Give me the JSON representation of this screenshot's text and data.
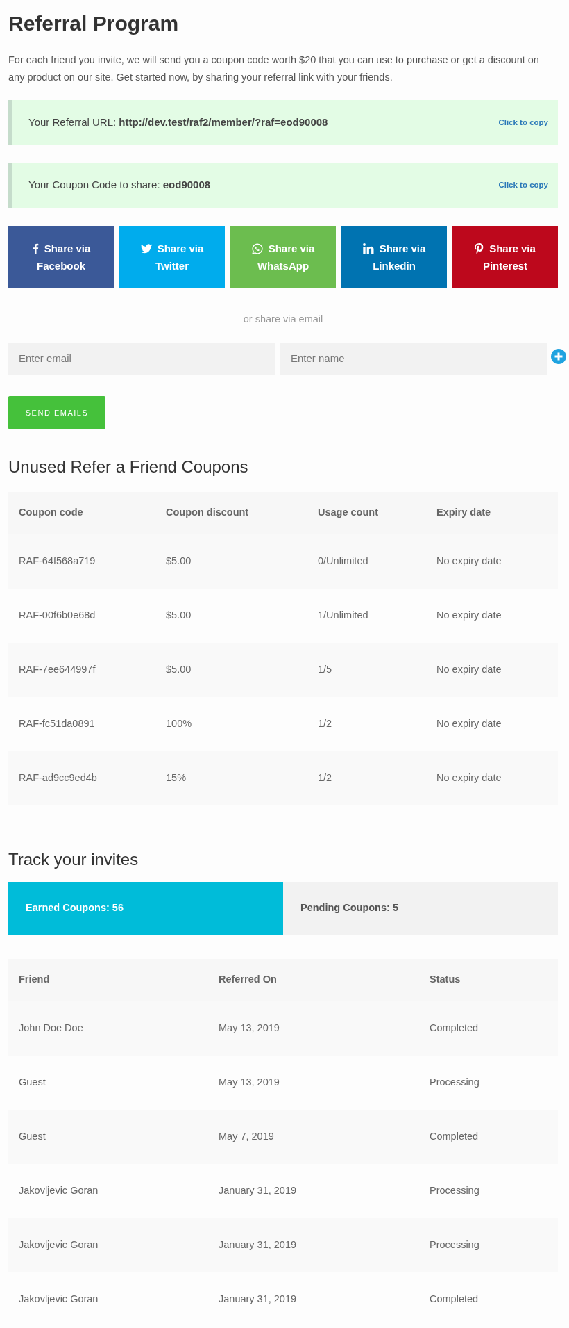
{
  "title": "Referral Program",
  "intro": "For each friend you invite, we will send you a coupon code worth $20 that you can use to purchase or get a discount on any product on our site. Get started now, by sharing your referral link with your friends.",
  "notices": [
    {
      "label": "Your Referral URL: **http://dev.test/raf2/member/?raf=eod90008**",
      "action": "Click to copy"
    },
    {
      "label": "Your Coupon Code to share: **eod90008**",
      "action": "Click to copy"
    }
  ],
  "share_buttons": [
    {
      "kind": "facebook",
      "color": "#3b5998",
      "line1": "Share via",
      "line2": "Facebook"
    },
    {
      "kind": "twitter",
      "color": "#00aced",
      "line1": "Share via",
      "line2": "Twitter"
    },
    {
      "kind": "whatsapp",
      "color": "#6cbd4f",
      "line1": "Share via",
      "line2": "WhatsApp"
    },
    {
      "kind": "linkedin",
      "color": "#0073b1",
      "line1": "Share via",
      "line2": "Linkedin"
    },
    {
      "kind": "pinterest",
      "color": "#bd081c",
      "line1": "Share via",
      "line2": "Pinterest"
    }
  ],
  "email_divider": "or share via email",
  "email_form": {
    "email": {
      "placeholder": "Enter email"
    },
    "name": {
      "placeholder": "Enter name"
    },
    "submit": "SEND EMAILS"
  },
  "coupons": {
    "heading": "Unused Refer a Friend Coupons",
    "columns": [
      "Coupon code",
      "Coupon discount",
      "Usage count",
      "Expiry date"
    ],
    "rows": [
      [
        "RAF-64f568a719",
        "$5.00",
        "0/Unlimited",
        "No expiry date"
      ],
      [
        "RAF-00f6b0e68d",
        "$5.00",
        "1/Unlimited",
        "No expiry date"
      ],
      [
        "RAF-7ee644997f",
        "$5.00",
        "1/5",
        "No expiry date"
      ],
      [
        "RAF-fc51da0891",
        "100%",
        "1/2",
        "No expiry date"
      ],
      [
        "RAF-ad9cc9ed4b",
        "15%",
        "1/2",
        "No expiry date"
      ]
    ]
  },
  "invites": {
    "heading": "Track your invites",
    "tabs": [
      {
        "label": "Earned Coupons: 56",
        "selected": true
      },
      {
        "label": "Pending Coupons: 5",
        "selected": false
      }
    ],
    "columns": [
      "Friend",
      "Referred On",
      "Status"
    ],
    "rows": [
      [
        "John Doe Doe",
        "May 13, 2019",
        "Completed"
      ],
      [
        "Guest",
        "May 13, 2019",
        "Processing"
      ],
      [
        "Guest",
        "May 7, 2019",
        "Completed"
      ],
      [
        "Jakovljevic Goran",
        "January 31, 2019",
        "Processing"
      ],
      [
        "Jakovljevic Goran",
        "January 31, 2019",
        "Processing"
      ],
      [
        "Jakovljevic Goran",
        "January 31, 2019",
        "Completed"
      ]
    ]
  }
}
